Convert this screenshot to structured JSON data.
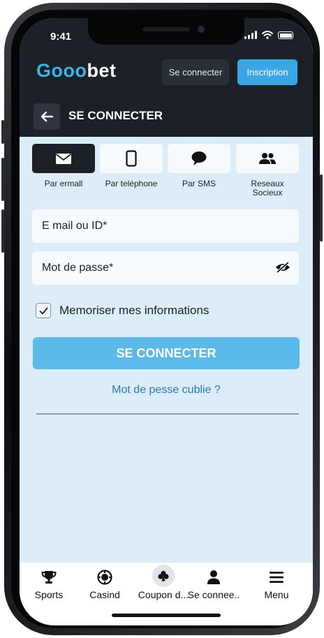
{
  "status_bar": {
    "time": "9:41"
  },
  "header": {
    "logo_part1": "Gooo",
    "logo_part2": "bet",
    "login_button": "Se connecter",
    "signup_button": "Inscription"
  },
  "page": {
    "title": "SE CONNECTER",
    "back_icon": "arrow-left-icon"
  },
  "login_methods": [
    {
      "label": "Par ermall",
      "icon": "envelope-icon",
      "active": true
    },
    {
      "label": "Par teléphone",
      "icon": "smartphone-icon",
      "active": false
    },
    {
      "label": "Par SMS",
      "icon": "chat-bubble-icon",
      "active": false
    },
    {
      "label": "Reseaux\nSocieux",
      "icon": "users-icon",
      "active": false
    }
  ],
  "form": {
    "email_placeholder": "E mail ou ID*",
    "password_placeholder": "Mot de passe*",
    "password_toggle_icon": "eye-off-icon",
    "remember_label": "Memoriser mes informations",
    "remember_checked": true,
    "submit_label": "SE CONNECTER",
    "forgot_link": "Mot de pesse cublie ?"
  },
  "bottom_nav": [
    {
      "label": "Sports",
      "icon": "trophy-icon"
    },
    {
      "label": "Casind",
      "icon": "chip-icon"
    },
    {
      "label": "Coupon d...",
      "icon": "club-icon"
    },
    {
      "label": "Se connee..",
      "icon": "user-icon"
    },
    {
      "label": "Menu",
      "icon": "hamburger-icon"
    }
  ],
  "colors": {
    "accent": "#3aa6e4",
    "header_bg": "#1c2128",
    "screen_bg": "#dcedf9",
    "link": "#2a78b3"
  }
}
